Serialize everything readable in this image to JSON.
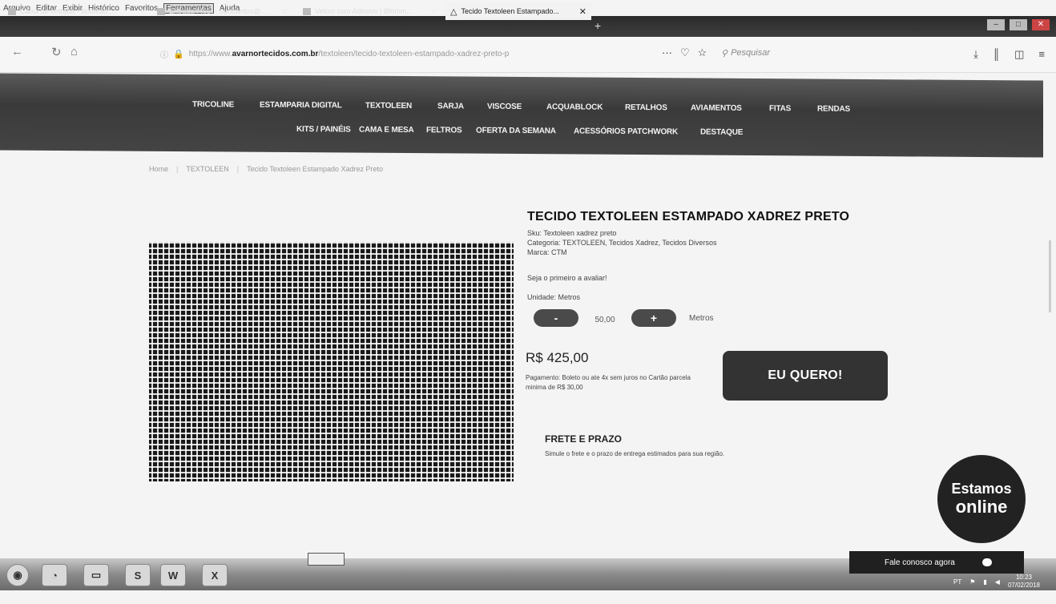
{
  "menubar": [
    "Arquivo",
    "Editar",
    "Exibir",
    "Histórico",
    "Favoritos",
    "Ferramentas",
    "Ajuda"
  ],
  "tabs": [
    {
      "label": "Caixa de entrada - licitacao..."
    },
    {
      "label": "Entrada (405) - baobantos@..."
    },
    {
      "label": "Velcro com Adesivo | Bfomm..."
    },
    {
      "label": "Tecido Textoleen Estampado..."
    }
  ],
  "address": {
    "prefix": "https://www.",
    "domain": "avarnortecidos.com.br",
    "path": "/textoleen/tecido-textoleen-estampado-xadrez-preto-p",
    "search_placeholder": "Pesquisar"
  },
  "nav": {
    "row1": [
      "TRICOLINE",
      "ESTAMPARIA DIGITAL",
      "TEXTOLEEN",
      "SARJA",
      "VISCOSE",
      "ACQUABLOCK",
      "RETALHOS",
      "AVIAMENTOS",
      "FITAS",
      "RENDAS"
    ],
    "row2": [
      "KITS / PAINÉIS",
      "CAMA E MESA",
      "FELTROS",
      "OFERTA DA SEMANA",
      "ACESSÓRIOS PATCHWORK",
      "DESTAQUE"
    ]
  },
  "breadcrumb": [
    "Home",
    "TEXTOLEEN",
    "Tecido Textoleen Estampado Xadrez Preto"
  ],
  "product": {
    "title": "TECIDO TEXTOLEEN ESTAMPADO XADREZ PRETO",
    "sku": "Sku: Textoleen xadrez preto",
    "category": "Categoria: TEXTOLEEN, Tecidos Xadrez, Tecidos Diversos",
    "brand": "Marca: CTM",
    "review": "Seja o primeiro a avaliar!",
    "unit_label": "Unidade: Metros",
    "minus": "-",
    "plus": "+",
    "quantity": "50,00",
    "quantity_unit": "Metros",
    "price": "R$ 425,00",
    "payment": "Pagamento: Boleto ou ate 4x sem juros no Cartão parcela minima de R$ 30,00",
    "buy_button": "EU QUERO!",
    "shipping_title": "FRETE E PRAZO",
    "shipping_desc": "Simule o frete e o prazo de entrega estimados para sua região."
  },
  "chat": {
    "line1": "Estamos",
    "line2": "online",
    "bar_label": "Fale conosco agora"
  },
  "tray": {
    "lang": "PT",
    "time": "10:23",
    "date": "07/02/2018"
  }
}
